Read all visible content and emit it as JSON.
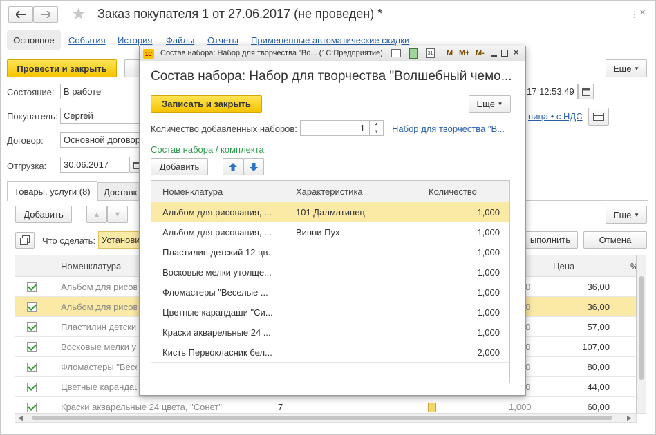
{
  "window": {
    "title": "Заказ покупателя 1 от 27.06.2017 (не проведен) *",
    "tabs": [
      "Основное",
      "События",
      "История",
      "Файлы",
      "Отчеты",
      "Примененные автоматические скидки"
    ],
    "post_close_label": "Провести и закрыть",
    "more_label": "Еще"
  },
  "form": {
    "status_label": "Состояние:",
    "status_value": "В работе",
    "date_value": "17 12:53:49",
    "buyer_label": "Покупатель:",
    "buyer_value": "Сергей",
    "contract_label": "Договор:",
    "contract_value": "Основной договор",
    "vat_link": "ница • с НДС",
    "shipment_label": "Отгрузка:",
    "shipment_value": "30.06.2017"
  },
  "inner_tabs": [
    "Товары, услуги (8)",
    "Доставк"
  ],
  "goods": {
    "add_label": "Добавить",
    "more_label": "Еще",
    "todo_label": "Что сделать:",
    "todo_value": "Установи",
    "execute_label": "ыполнить",
    "cancel_label": "Отмена",
    "col_nomen": "Номенклатура",
    "col_price": "Цена",
    "col_percent": "%",
    "rows": [
      {
        "name": "Альбом для рисова",
        "qty": "",
        "sum": "0",
        "price": "36,00"
      },
      {
        "name": "Альбом для рисова",
        "qty": "",
        "sum": "0",
        "price": "36,00"
      },
      {
        "name": "Пластилин детский",
        "qty": "",
        "sum": "0",
        "price": "57,00"
      },
      {
        "name": "Восковые мелки у",
        "qty": "",
        "sum": "0",
        "price": "107,00"
      },
      {
        "name": "Фломастеры \"Весе",
        "qty": "",
        "sum": "0",
        "price": "80,00"
      },
      {
        "name": "Цветные карандаш",
        "qty": "",
        "sum": "0",
        "price": "44,00"
      },
      {
        "name": "Краски акварельные 24 цвета, \"Сонет\"",
        "qty": "7",
        "sum": "1,000",
        "price": "60,00"
      }
    ]
  },
  "dialog": {
    "title": "Состав набора: Набор для творчества \"Во... (1С:Предприятие)",
    "m_labels": [
      "M",
      "M+",
      "M-"
    ],
    "heading": "Состав набора: Набор для творчества \"Волшебный чемо...",
    "save_close_label": "Записать и закрыть",
    "more_label": "Еще",
    "count_label": "Количество добавленных наборов:",
    "count_value": "1",
    "kit_link": "Набор для творчества \"В...",
    "section_label": "Состав набора / комплекта:",
    "add_label": "Добавить",
    "columns": [
      "Номенклатура",
      "Характеристика",
      "Количество"
    ],
    "rows": [
      {
        "name": "Альбом для рисования, ...",
        "char": "101 Далматинец",
        "qty": "1,000"
      },
      {
        "name": "Альбом для рисования, ...",
        "char": "Винни Пух",
        "qty": "1,000"
      },
      {
        "name": "Пластилин детский 12 цв.",
        "char": "",
        "qty": "1,000"
      },
      {
        "name": "Восковые мелки утолще...",
        "char": "",
        "qty": "1,000"
      },
      {
        "name": "Фломастеры \"Веселые ...",
        "char": "",
        "qty": "1,000"
      },
      {
        "name": "Цветные карандаши \"Си...",
        "char": "",
        "qty": "1,000"
      },
      {
        "name": "Краски акварельные 24 ...",
        "char": "",
        "qty": "1,000"
      },
      {
        "name": "Кисть Первокласник бел...",
        "char": "",
        "qty": "2,000"
      }
    ]
  },
  "colors": {
    "accent_yellow": "#f5c400",
    "selected_row": "#fbe9a6",
    "link": "#2a5faa",
    "section_green": "#2e9a4e"
  }
}
